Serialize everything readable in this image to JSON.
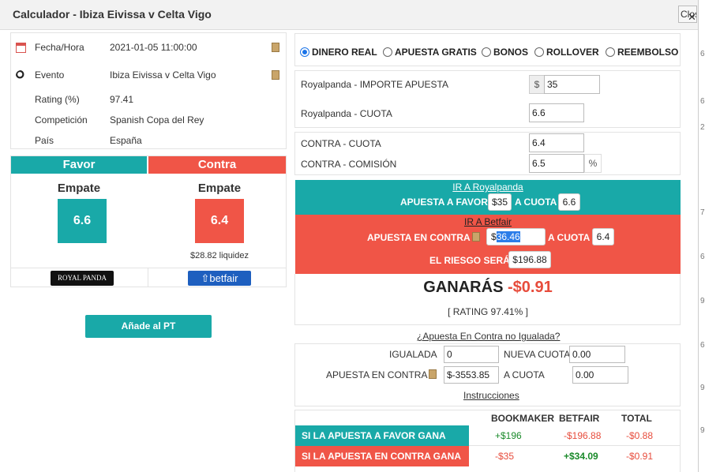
{
  "header": {
    "title": "Calculador - Ibiza Eivissa v Celta Vigo",
    "close_label": "Close"
  },
  "scroll_edge_chars": [
    "6",
    "6",
    "2",
    "7",
    "6",
    "9",
    "6",
    "9",
    "9"
  ],
  "info": {
    "rows": [
      {
        "label": "Fecha/Hora",
        "value": "2021-01-05 11:00:00"
      },
      {
        "label": "Evento",
        "value": "Ibiza Eivissa v Celta Vigo"
      },
      {
        "label": "Rating (%)",
        "value": "97.41"
      },
      {
        "label": "Competición",
        "value": "Spanish Copa del Rey"
      },
      {
        "label": "País",
        "value": "España"
      }
    ]
  },
  "favor": {
    "header": "Favor",
    "outcome": "Empate",
    "odds": "6.6",
    "brand": "ROYAL PANDA"
  },
  "contra": {
    "header": "Contra",
    "outcome": "Empate",
    "odds": "6.4",
    "liquidity": "$28.82 liquidez",
    "brand": "betfair"
  },
  "add_button": "Añade al PT",
  "bet_types": [
    "DINERO REAL",
    "APUESTA GRATIS",
    "BONOS",
    "ROLLOVER",
    "REEMBOLSO"
  ],
  "selected_bet_type": "DINERO REAL",
  "bookmaker_form": {
    "stake_label": "Royalpanda - IMPORTE APUESTA",
    "currency": "$",
    "stake_value": "35",
    "odds_label": "Royalpanda - CUOTA",
    "odds_value": "6.6"
  },
  "exchange_form": {
    "odds_label": "CONTRA - CUOTA",
    "odds_value": "6.4",
    "commission_label": "CONTRA - COMISIÓN",
    "commission_value": "6.5",
    "commission_unit": "%"
  },
  "favor_band": {
    "link": "IR A Royalpanda",
    "text": "APUESTA A FAVOR",
    "amount": "$35",
    "odds_text": "A CUOTA",
    "odds": "6.6"
  },
  "contra_band": {
    "link": "IR A Betfair",
    "text": "APUESTA EN CONTRA",
    "currency": "$",
    "amount": "36.46",
    "odds_text": "A CUOTA",
    "odds": "6.4",
    "risk_text": "EL RIESGO SERÁ",
    "risk": "$196.88"
  },
  "result": {
    "label": "GANARÁS",
    "value": "-$0.91",
    "rating": "[ RATING 97.41% ]"
  },
  "unmatched": {
    "title": "¿Apuesta En Contra no Igualada?",
    "matched_label": "IGUALADA",
    "matched_value": "0",
    "new_odds_label": "NUEVA CUOTA",
    "new_odds_value": "0.00",
    "lay_label": "APUESTA EN CONTRA",
    "lay_value": "$-3553.85",
    "lay_odds_label": "A CUOTA",
    "lay_odds_value": "0.00",
    "instructions": "Instrucciones"
  },
  "summary": {
    "headers": [
      "BOOKMAKER",
      "BETFAIR",
      "TOTAL"
    ],
    "rows": [
      {
        "label": "SI LA APUESTA A FAVOR GANA",
        "bookmaker": "+$196",
        "betfair": "-$196.88",
        "total": "-$0.88"
      },
      {
        "label": "SI LA APUESTA EN CONTRA GANA",
        "bookmaker": "-$35",
        "betfair": "+$34.09",
        "total": "-$0.91"
      }
    ]
  },
  "colors": {
    "teal": "#19a9a8",
    "red": "#f05547",
    "positive": "#1a8a2a",
    "negative": "#e74c3c"
  }
}
